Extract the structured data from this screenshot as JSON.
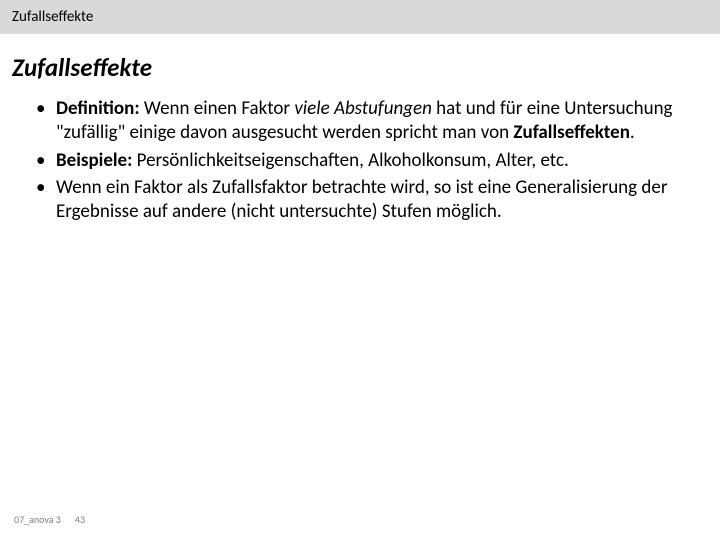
{
  "header": {
    "title": "Zufallseffekte"
  },
  "title": "Zufallseffekte",
  "bullets": {
    "b1": {
      "label": "Definition:",
      "t1": " Wenn einen Faktor ",
      "em": "viele Abstufungen",
      "t2": " hat und für eine Untersuchung \"zufällig\" einige davon ausgesucht werden spricht man von ",
      "strong": "Zufallseffekten",
      "t3": "."
    },
    "b2": {
      "label": "Beispiele:",
      "t1": " Persönlichkeitseigenschaften, Alkoholkonsum, Alter, etc."
    },
    "b3": {
      "t1": "Wenn ein Faktor als Zufallsfaktor betrachte wird, so ist eine Generalisierung der Ergebnisse auf andere (nicht untersuchte) Stufen möglich."
    }
  },
  "footer": {
    "filename": "07_anova 3",
    "page": "43"
  }
}
